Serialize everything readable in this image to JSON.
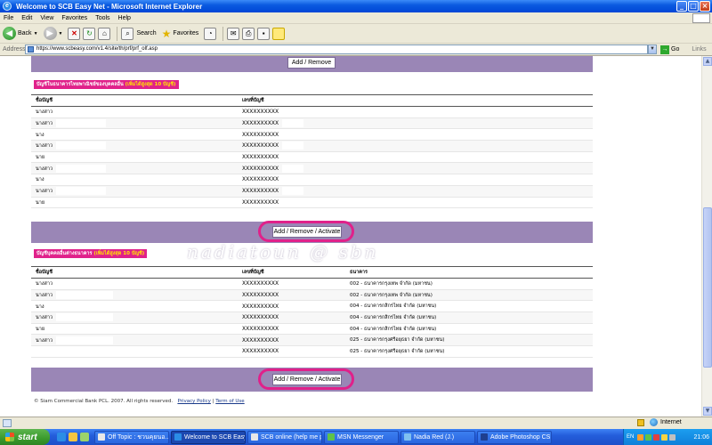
{
  "window": {
    "title": "Welcome to SCB Easy Net - Microsoft Internet Explorer"
  },
  "menu": [
    "File",
    "Edit",
    "View",
    "Favorites",
    "Tools",
    "Help"
  ],
  "toolbar": {
    "back_label": "Back",
    "search_label": "Search",
    "favorites_label": "Favorites"
  },
  "address": {
    "label": "Address",
    "url": "https://www.scbeasy.com/v1.4/site/th/prf/prf_olf.asp",
    "go_label": "Go",
    "links_label": "Links"
  },
  "page": {
    "top_button": "Add / Remove",
    "section1": {
      "title": "บัญชีในธนาคารไทยพาณิชย์ของบุคคลอื่น",
      "title_note": "(เพิ่มได้สูงสุด 10 บัญชี)",
      "columns": [
        "ชื่อบัญชี",
        "เลขที่บัญชี"
      ],
      "rows": [
        {
          "prefix": "นางสาว",
          "account": "XXXXXXXXXX"
        },
        {
          "prefix": "นางสาว",
          "account": "XXXXXXXXXX"
        },
        {
          "prefix": "นาง",
          "account": "XXXXXXXXXX"
        },
        {
          "prefix": "นางสาว",
          "account": "XXXXXXXXXX"
        },
        {
          "prefix": "นาย",
          "account": "XXXXXXXXXX"
        },
        {
          "prefix": "นางสาว",
          "account": "XXXXXXXXXX"
        },
        {
          "prefix": "นาง",
          "account": "XXXXXXXXXX"
        },
        {
          "prefix": "นางสาว",
          "account": "XXXXXXXXXX"
        },
        {
          "prefix": "นาย",
          "account": "XXXXXXXXXX"
        }
      ],
      "button": "Add / Remove / Activate"
    },
    "section2": {
      "title": "บัญชีบุคคลอื่นต่างธนาคาร",
      "title_note": "(เพิ่มได้สูงสุด 10 บัญชี)",
      "columns": [
        "ชื่อบัญชี",
        "เลขที่บัญชี",
        "ธนาคาร"
      ],
      "rows": [
        {
          "prefix": "นางสาว",
          "account": "XXXXXXXXXX",
          "bank": "002 - ธนาคารกรุงเทพ จำกัด (มหาชน)"
        },
        {
          "prefix": "นางสาว",
          "account": "XXXXXXXXXX",
          "bank": "002 - ธนาคารกรุงเทพ จำกัด (มหาชน)"
        },
        {
          "prefix": "นาง",
          "account": "XXXXXXXXXX",
          "bank": "004 - ธนาคารกสิกรไทย จำกัด (มหาชน)"
        },
        {
          "prefix": "นางสาว",
          "account": "XXXXXXXXXX",
          "bank": "004 - ธนาคารกสิกรไทย จำกัด (มหาชน)"
        },
        {
          "prefix": "นาย",
          "account": "XXXXXXXXXX",
          "bank": "004 - ธนาคารกสิกรไทย จำกัด (มหาชน)"
        },
        {
          "prefix": "นางสาว",
          "account": "XXXXXXXXXX",
          "bank": "025 - ธนาคารกรุงศรีอยุธยา จำกัด (มหาชน)"
        },
        {
          "prefix": "",
          "account": "XXXXXXXXXX",
          "bank": "025 - ธนาคารกรุงศรีอยุธยา จำกัด (มหาชน)"
        }
      ],
      "button": "Add / Remove / Activate"
    },
    "watermark": "nadiatoun @ sbn",
    "footer": {
      "copyright": "© Siam Commercial Bank PCL. 2007. All rights reserved.",
      "privacy": "Privacy Policy",
      "separator": "|",
      "terms": "Term of Use"
    }
  },
  "status": {
    "zone": "Internet"
  },
  "taskbar": {
    "start": "start",
    "tasks": [
      {
        "label": "Off Topic : ชวนคุยนอ...",
        "active": false,
        "color": "#e8e8e8"
      },
      {
        "label": "Welcome to SCB Easy...",
        "active": true,
        "color": "#2b8de6"
      },
      {
        "label": "SCB online (help me p...",
        "active": false,
        "color": "#e8e8e8"
      },
      {
        "label": "MSN Messenger",
        "active": false,
        "color": "#5fc24a"
      },
      {
        "label": "Nadia Red (J.)",
        "active": false,
        "color": "#7fc0f0"
      },
      {
        "label": "Adobe Photoshop CS...",
        "active": false,
        "color": "#1f3f8f"
      }
    ],
    "lang": "EN",
    "clock": "21:06"
  },
  "colors": {
    "accent_purple": "#9a86b6",
    "highlight_pink": "#e0218a",
    "xp_blue": "#245edb"
  }
}
